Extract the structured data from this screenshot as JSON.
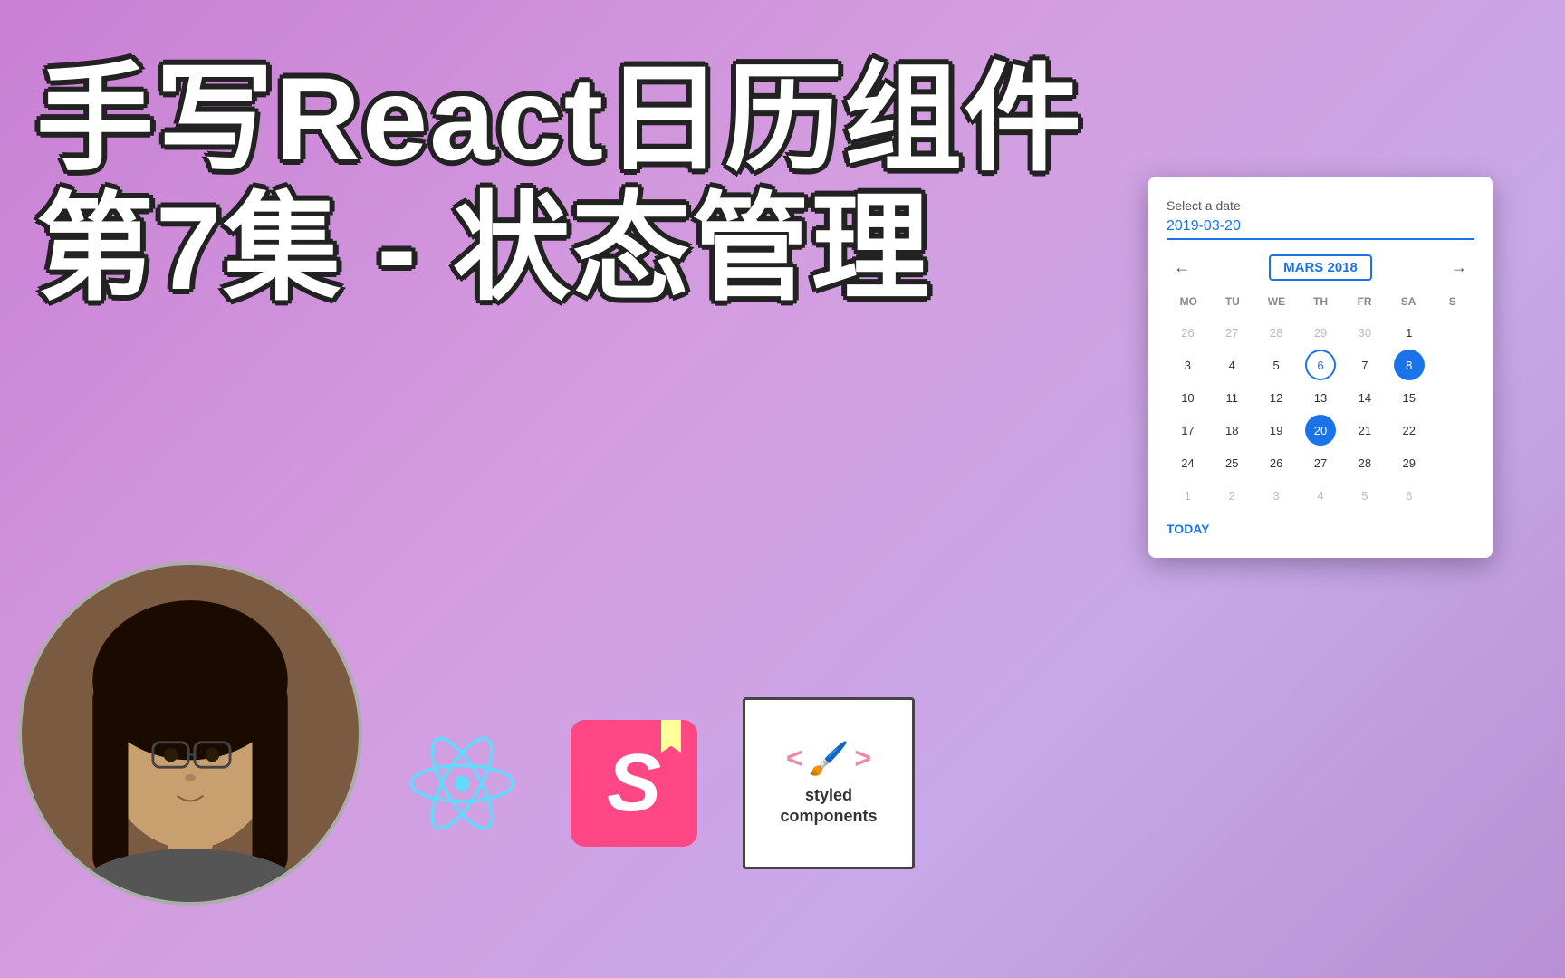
{
  "background": {
    "gradient_start": "#c97fd4",
    "gradient_end": "#b88fd4"
  },
  "title": {
    "line1": "手写React日历组件",
    "line2": "第7集 - 状态管理"
  },
  "icons": {
    "react_label": "React",
    "storybook_label": "S",
    "sc_label": "styled\ncomponents",
    "sc_bracket_left": "<",
    "sc_brush": "🖌",
    "sc_bracket_right": ">"
  },
  "calendar": {
    "label": "Select a date",
    "date_value": "2019-03-20",
    "month_title": "MARS 2018",
    "nav_prev": "←",
    "nav_next": "",
    "weekdays": [
      "MO",
      "TU",
      "WE",
      "TH",
      "FR",
      "SA",
      "S"
    ],
    "weeks": [
      [
        {
          "d": "26",
          "m": "other"
        },
        {
          "d": "27",
          "m": "other"
        },
        {
          "d": "28",
          "m": "other"
        },
        {
          "d": "29",
          "m": "other"
        },
        {
          "d": "30",
          "m": "other"
        },
        {
          "d": "1",
          "m": ""
        },
        {
          "d": "",
          "m": "other"
        }
      ],
      [
        {
          "d": "3",
          "m": ""
        },
        {
          "d": "4",
          "m": ""
        },
        {
          "d": "5",
          "m": ""
        },
        {
          "d": "6",
          "m": "highlighted"
        },
        {
          "d": "7",
          "m": ""
        },
        {
          "d": "8",
          "m": "selected"
        },
        {
          "d": "",
          "m": "other"
        }
      ],
      [
        {
          "d": "10",
          "m": ""
        },
        {
          "d": "11",
          "m": ""
        },
        {
          "d": "12",
          "m": ""
        },
        {
          "d": "13",
          "m": ""
        },
        {
          "d": "14",
          "m": ""
        },
        {
          "d": "15",
          "m": ""
        },
        {
          "d": "",
          "m": "other"
        }
      ],
      [
        {
          "d": "17",
          "m": ""
        },
        {
          "d": "18",
          "m": ""
        },
        {
          "d": "19",
          "m": ""
        },
        {
          "d": "20",
          "m": "selected"
        },
        {
          "d": "21",
          "m": ""
        },
        {
          "d": "22",
          "m": ""
        },
        {
          "d": "",
          "m": "other"
        }
      ],
      [
        {
          "d": "24",
          "m": ""
        },
        {
          "d": "25",
          "m": ""
        },
        {
          "d": "26",
          "m": ""
        },
        {
          "d": "27",
          "m": ""
        },
        {
          "d": "28",
          "m": ""
        },
        {
          "d": "29",
          "m": ""
        },
        {
          "d": "",
          "m": "other"
        }
      ],
      [
        {
          "d": "1",
          "m": "other"
        },
        {
          "d": "2",
          "m": "other"
        },
        {
          "d": "3",
          "m": "other"
        },
        {
          "d": "4",
          "m": "other"
        },
        {
          "d": "5",
          "m": "other"
        },
        {
          "d": "6",
          "m": "other"
        },
        {
          "d": "",
          "m": "other"
        }
      ]
    ],
    "today_label": "TODAY"
  }
}
